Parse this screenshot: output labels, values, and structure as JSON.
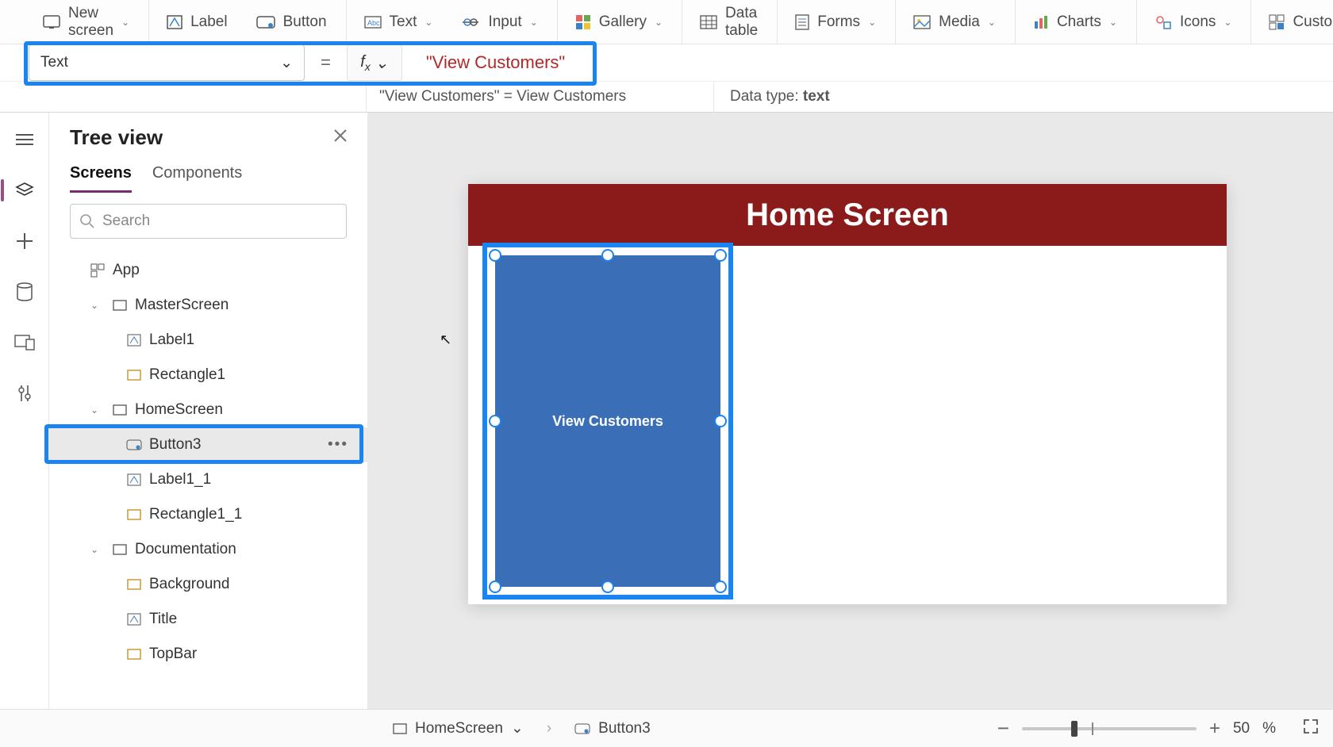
{
  "ribbon": {
    "new_screen": "New screen",
    "label": "Label",
    "button": "Button",
    "text": "Text",
    "input": "Input",
    "gallery": "Gallery",
    "data_table": "Data table",
    "forms": "Forms",
    "media": "Media",
    "charts": "Charts",
    "icons": "Icons",
    "custom": "Custom"
  },
  "formula": {
    "property": "Text",
    "expression": "\"View Customers\"",
    "result_left": "\"View Customers\"  =  View Customers",
    "data_type_label": "Data type: ",
    "data_type": "text"
  },
  "tree": {
    "title": "Tree view",
    "tab_screens": "Screens",
    "tab_components": "Components",
    "search_placeholder": "Search",
    "app": "App",
    "items": [
      {
        "name": "MasterScreen"
      },
      {
        "name": "Label1"
      },
      {
        "name": "Rectangle1"
      },
      {
        "name": "HomeScreen"
      },
      {
        "name": "Button3"
      },
      {
        "name": "Label1_1"
      },
      {
        "name": "Rectangle1_1"
      },
      {
        "name": "Documentation"
      },
      {
        "name": "Background"
      },
      {
        "name": "Title"
      },
      {
        "name": "TopBar"
      }
    ]
  },
  "canvas": {
    "header": "Home Screen",
    "button_text": "View Customers"
  },
  "status": {
    "crumb_screen": "HomeScreen",
    "crumb_control": "Button3",
    "zoom_value": "50",
    "zoom_unit": "%"
  }
}
